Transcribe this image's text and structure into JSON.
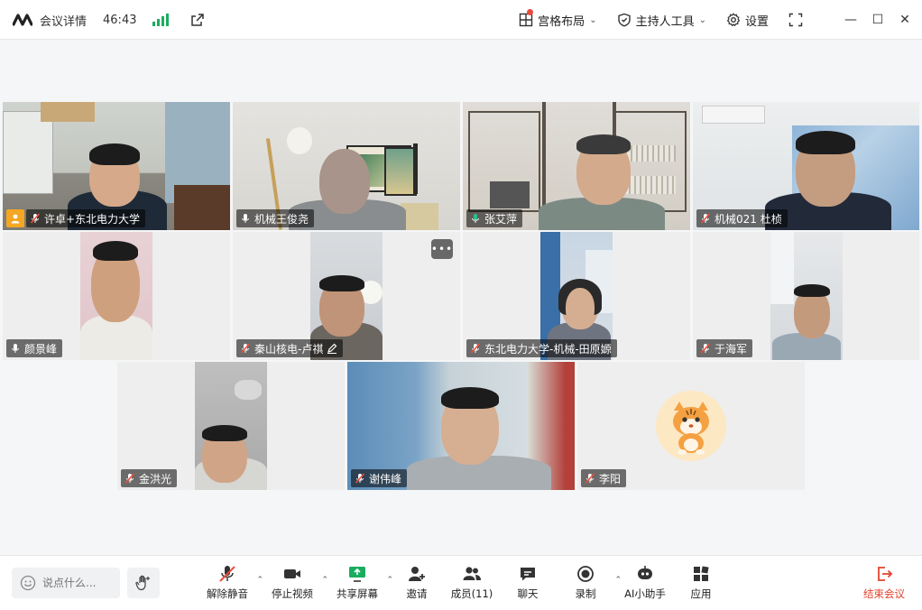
{
  "titlebar": {
    "meeting_details": "会议详情",
    "timer": "46:43",
    "grid_layout": "宫格布局",
    "host_tools": "主持人工具",
    "settings": "设置"
  },
  "participants": [
    {
      "name": "许卓+东北电力大学",
      "host": true,
      "muted": true
    },
    {
      "name": "机械王俊尧",
      "host": false,
      "muted": false
    },
    {
      "name": "张艾萍",
      "host": false,
      "muted": false,
      "speaking": true
    },
    {
      "name": "机械021 杜桢",
      "host": false,
      "muted": true
    },
    {
      "name": "颜景峰",
      "host": false,
      "muted": false
    },
    {
      "name": "秦山核电-卢祺",
      "host": false,
      "muted": true
    },
    {
      "name": "东北电力大学-机械-田原嫄",
      "host": false,
      "muted": true
    },
    {
      "name": "于海军",
      "host": false,
      "muted": true
    },
    {
      "name": "金洪光",
      "host": false,
      "muted": true
    },
    {
      "name": "谢伟峰",
      "host": false,
      "muted": true
    },
    {
      "name": "李阳",
      "host": false,
      "muted": true
    }
  ],
  "bottombar": {
    "chat_placeholder": "说点什么...",
    "unmute": "解除静音",
    "stop_video": "停止视频",
    "share_screen": "共享屏幕",
    "invite": "邀请",
    "members": "成员(11)",
    "chat": "聊天",
    "record": "录制",
    "ai_assistant": "AI小助手",
    "apps": "应用",
    "end_meeting": "结束会议"
  },
  "colors": {
    "accent_green": "#2dbd8a",
    "signal_green": "#1aad5f",
    "end_red": "#e0432e",
    "host_badge": "#f5a623"
  }
}
